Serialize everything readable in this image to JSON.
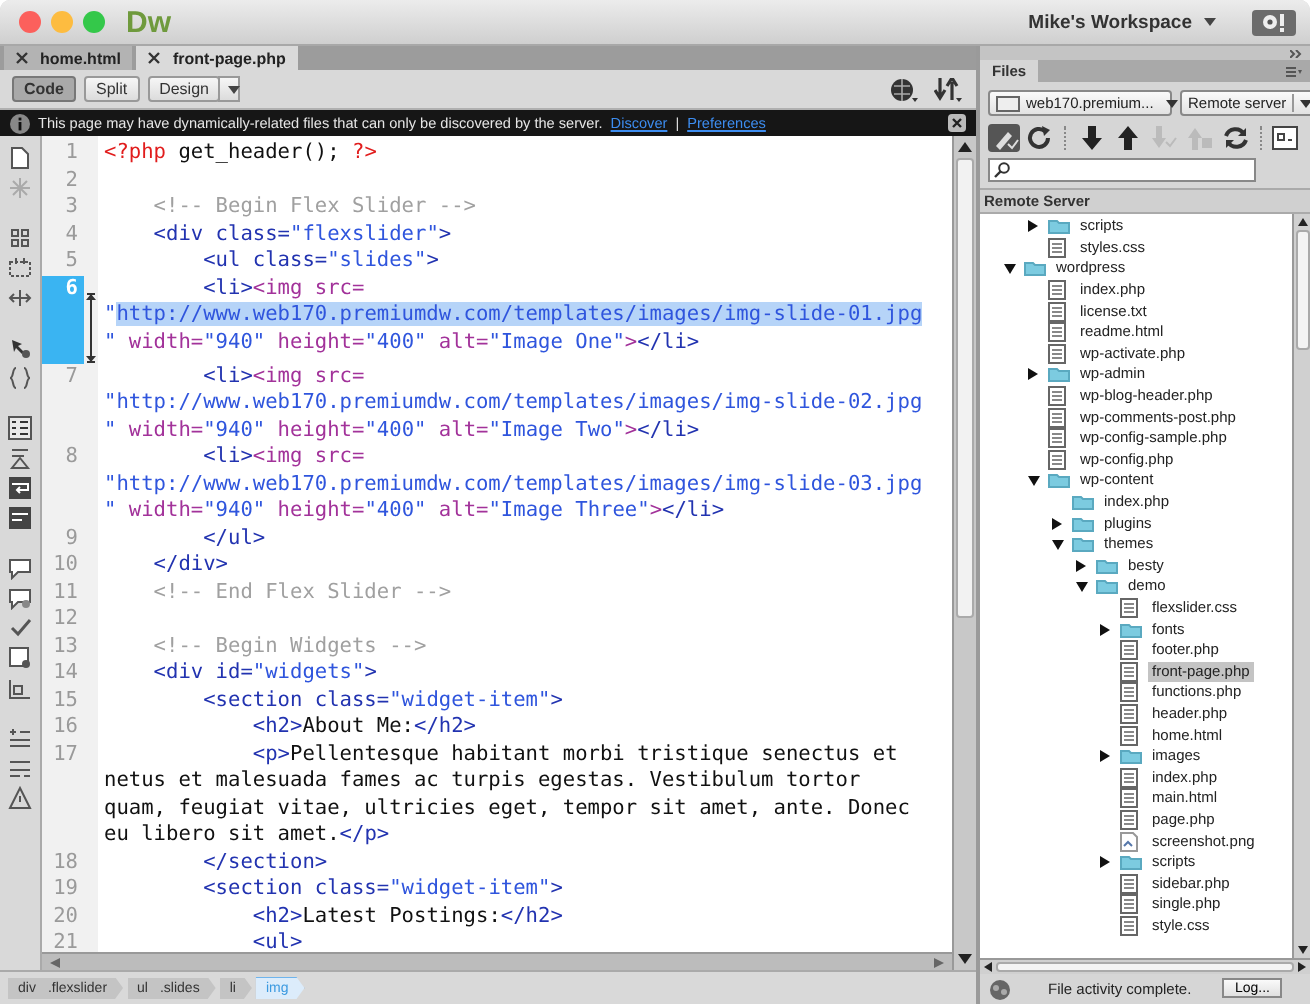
{
  "window": {
    "app_logo": "Dw",
    "workspace": "Mike's Workspace"
  },
  "document_tabs": [
    {
      "label": "home.html",
      "selected": false
    },
    {
      "label": "front-page.php",
      "selected": true
    }
  ],
  "view_buttons": [
    {
      "label": "Code",
      "selected": true
    },
    {
      "label": "Split",
      "selected": false
    },
    {
      "label": "Design",
      "selected": false
    }
  ],
  "info_bar": {
    "message": "This page may have dynamically-related files that can only be discovered by the server.",
    "links": [
      "Discover",
      "Preferences"
    ],
    "separator": "|"
  },
  "code_lines": [
    {
      "number": "1",
      "selected": false,
      "wraps": [
        {
          "spans": [
            {
              "kind": "php",
              "text": "<?php"
            },
            {
              "kind": "text",
              "text": " get_header(); "
            },
            {
              "kind": "php",
              "text": "?>"
            }
          ]
        }
      ]
    },
    {
      "number": "2",
      "selected": false
    },
    {
      "number": "3",
      "selected": false,
      "wraps": [
        {
          "spans": [
            {
              "kind": "comment",
              "text": "    <!-- Begin Flex Slider -->"
            }
          ]
        }
      ]
    },
    {
      "number": "4",
      "selected": false,
      "wraps": [
        {
          "spans": [
            {
              "kind": "tag",
              "text": "    <div class="
            },
            {
              "kind": "value",
              "text": "\"flexslider\""
            },
            {
              "kind": "tag",
              "text": ">"
            }
          ]
        }
      ]
    },
    {
      "number": "5",
      "selected": false,
      "wraps": [
        {
          "spans": [
            {
              "kind": "tag",
              "text": "        <ul class="
            },
            {
              "kind": "value",
              "text": "\"slides\""
            },
            {
              "kind": "tag",
              "text": ">"
            }
          ]
        }
      ]
    },
    {
      "number": "6",
      "selected": true,
      "wraps": [
        {
          "spans": [
            {
              "kind": "tag",
              "text": "        <li>"
            },
            {
              "kind": "img",
              "text": "<img src="
            }
          ]
        },
        {
          "spans": [
            {
              "kind": "value",
              "text": "\""
            },
            {
              "kind": "selected-text",
              "text": "http://www.web170.premiumdw.com/templates/images/img-slide-01.jpg"
            }
          ]
        },
        {
          "spans": [
            {
              "kind": "value",
              "text": "\""
            },
            {
              "kind": "img",
              "text": " width="
            },
            {
              "kind": "value",
              "text": "\"940\""
            },
            {
              "kind": "img",
              "text": " height="
            },
            {
              "kind": "value",
              "text": "\"400\""
            },
            {
              "kind": "img",
              "text": " alt="
            },
            {
              "kind": "value",
              "text": "\"Image One\""
            },
            {
              "kind": "img",
              "text": ">"
            },
            {
              "kind": "tag",
              "text": "</li>"
            }
          ]
        }
      ]
    },
    {
      "number": "7",
      "selected": false,
      "wraps": [
        {
          "spans": [
            {
              "kind": "tag",
              "text": "        <li>"
            },
            {
              "kind": "img",
              "text": "<img src="
            }
          ]
        },
        {
          "spans": [
            {
              "kind": "value",
              "text": "\"http://www.web170.premiumdw.com/templates/images/img-slide-02.jpg"
            }
          ]
        },
        {
          "spans": [
            {
              "kind": "value",
              "text": "\""
            },
            {
              "kind": "img",
              "text": " width="
            },
            {
              "kind": "value",
              "text": "\"940\""
            },
            {
              "kind": "img",
              "text": " height="
            },
            {
              "kind": "value",
              "text": "\"400\""
            },
            {
              "kind": "img",
              "text": " alt="
            },
            {
              "kind": "value",
              "text": "\"Image Two\""
            },
            {
              "kind": "img",
              "text": ">"
            },
            {
              "kind": "tag",
              "text": "</li>"
            }
          ]
        }
      ]
    },
    {
      "number": "8",
      "selected": false,
      "wraps": [
        {
          "spans": [
            {
              "kind": "tag",
              "text": "        <li>"
            },
            {
              "kind": "img",
              "text": "<img src="
            }
          ]
        },
        {
          "spans": [
            {
              "kind": "value",
              "text": "\"http://www.web170.premiumdw.com/templates/images/img-slide-03.jpg"
            }
          ]
        },
        {
          "spans": [
            {
              "kind": "value",
              "text": "\""
            },
            {
              "kind": "img",
              "text": " width="
            },
            {
              "kind": "value",
              "text": "\"940\""
            },
            {
              "kind": "img",
              "text": " height="
            },
            {
              "kind": "value",
              "text": "\"400\""
            },
            {
              "kind": "img",
              "text": " alt="
            },
            {
              "kind": "value",
              "text": "\"Image Three\""
            },
            {
              "kind": "img",
              "text": ">"
            },
            {
              "kind": "tag",
              "text": "</li>"
            }
          ]
        }
      ]
    },
    {
      "number": "9",
      "selected": false,
      "wraps": [
        {
          "spans": [
            {
              "kind": "tag",
              "text": "        </ul>"
            }
          ]
        }
      ]
    },
    {
      "number": "10",
      "selected": false,
      "wraps": [
        {
          "spans": [
            {
              "kind": "tag",
              "text": "    </div>"
            }
          ]
        }
      ]
    },
    {
      "number": "11",
      "selected": false,
      "wraps": [
        {
          "spans": [
            {
              "kind": "comment",
              "text": "    <!-- End Flex Slider -->"
            }
          ]
        }
      ]
    },
    {
      "number": "12",
      "selected": false
    },
    {
      "number": "13",
      "selected": false,
      "wraps": [
        {
          "spans": [
            {
              "kind": "comment",
              "text": "    <!-- Begin Widgets -->"
            }
          ]
        }
      ]
    },
    {
      "number": "14",
      "selected": false,
      "wraps": [
        {
          "spans": [
            {
              "kind": "tag",
              "text": "    <div id="
            },
            {
              "kind": "value",
              "text": "\"widgets\""
            },
            {
              "kind": "tag",
              "text": ">"
            }
          ]
        }
      ]
    },
    {
      "number": "15",
      "selected": false,
      "wraps": [
        {
          "spans": [
            {
              "kind": "tag",
              "text": "        <section class="
            },
            {
              "kind": "value",
              "text": "\"widget-item\""
            },
            {
              "kind": "tag",
              "text": ">"
            }
          ]
        }
      ]
    },
    {
      "number": "16",
      "selected": false,
      "wraps": [
        {
          "spans": [
            {
              "kind": "tag",
              "text": "            <h2>"
            },
            {
              "kind": "text",
              "text": "About Me:"
            },
            {
              "kind": "tag",
              "text": "</h2>"
            }
          ]
        }
      ]
    },
    {
      "number": "17",
      "selected": false,
      "wraps": [
        {
          "spans": [
            {
              "kind": "tag",
              "text": "            <p>"
            },
            {
              "kind": "text",
              "text": "Pellentesque habitant morbi tristique senectus et"
            }
          ]
        },
        {
          "spans": [
            {
              "kind": "text",
              "text": "netus et malesuada fames ac turpis egestas. Vestibulum tortor"
            }
          ]
        },
        {
          "spans": [
            {
              "kind": "text",
              "text": "quam, feugiat vitae, ultricies eget, tempor sit amet, ante. Donec"
            }
          ]
        },
        {
          "spans": [
            {
              "kind": "text",
              "text": "eu libero sit amet."
            },
            {
              "kind": "tag",
              "text": "</p>"
            }
          ]
        }
      ]
    },
    {
      "number": "18",
      "selected": false,
      "wraps": [
        {
          "spans": [
            {
              "kind": "tag",
              "text": "        </section>"
            }
          ]
        }
      ]
    },
    {
      "number": "19",
      "selected": false,
      "wraps": [
        {
          "spans": [
            {
              "kind": "tag",
              "text": "        <section class="
            },
            {
              "kind": "value",
              "text": "\"widget-item\""
            },
            {
              "kind": "tag",
              "text": ">"
            }
          ]
        }
      ]
    },
    {
      "number": "20",
      "selected": false,
      "wraps": [
        {
          "spans": [
            {
              "kind": "tag",
              "text": "            <h2>"
            },
            {
              "kind": "text",
              "text": "Latest Postings:"
            },
            {
              "kind": "tag",
              "text": "</h2>"
            }
          ]
        }
      ]
    },
    {
      "number": "21",
      "selected": false,
      "wraps": [
        {
          "spans": [
            {
              "kind": "tag",
              "text": "            <ul>"
            }
          ]
        }
      ]
    }
  ],
  "tag_selector": [
    {
      "tag": "div",
      "class": ".flexslider",
      "selected": false
    },
    {
      "tag": "ul",
      "class": ".slides",
      "selected": false
    },
    {
      "tag": "li",
      "selected": false
    },
    {
      "tag": "img",
      "selected": true
    }
  ],
  "files_panel": {
    "tab": "Files",
    "site": "web170.premium...",
    "server": "Remote server",
    "header": "Remote Server",
    "tree": {
      "scrolled_children": [
        {
          "name": "scripts",
          "kind": "folder",
          "expanded": false,
          "selected": false
        },
        {
          "name": "styles.css",
          "kind": "file",
          "selected": false
        }
      ],
      "items": [
        {
          "name": "wordpress",
          "kind": "folder",
          "expanded": true,
          "selected": false,
          "children": [
            {
              "name": "index.php",
              "kind": "file",
              "selected": false
            },
            {
              "name": "license.txt",
              "kind": "file",
              "selected": false
            },
            {
              "name": "readme.html",
              "kind": "file",
              "selected": false
            },
            {
              "name": "wp-activate.php",
              "kind": "file",
              "selected": false
            },
            {
              "name": "wp-admin",
              "kind": "folder",
              "expanded": false,
              "selected": false
            },
            {
              "name": "wp-blog-header.php",
              "kind": "file",
              "selected": false
            },
            {
              "name": "wp-comments-post.php",
              "kind": "file",
              "selected": false
            },
            {
              "name": "wp-config-sample.php",
              "kind": "file",
              "selected": false
            },
            {
              "name": "wp-config.php",
              "kind": "file",
              "selected": false
            },
            {
              "name": "wp-content",
              "kind": "folder",
              "expanded": true,
              "selected": false,
              "children": [
                {
                  "name": "index.php",
                  "kind": "folder",
                  "selected": false
                },
                {
                  "name": "plugins",
                  "kind": "folder",
                  "expanded": false,
                  "selected": false
                },
                {
                  "name": "themes",
                  "kind": "folder",
                  "expanded": true,
                  "selected": false,
                  "children": [
                    {
                      "name": "besty",
                      "kind": "folder",
                      "expanded": false,
                      "selected": false
                    },
                    {
                      "name": "demo",
                      "kind": "folder",
                      "expanded": true,
                      "selected": false,
                      "children": [
                        {
                          "name": "flexslider.css",
                          "kind": "file",
                          "selected": false
                        },
                        {
                          "name": "fonts",
                          "kind": "folder",
                          "expanded": false,
                          "selected": false
                        },
                        {
                          "name": "footer.php",
                          "kind": "file",
                          "selected": false
                        },
                        {
                          "name": "front-page.php",
                          "kind": "file",
                          "selected": true
                        },
                        {
                          "name": "functions.php",
                          "kind": "file",
                          "selected": false
                        },
                        {
                          "name": "header.php",
                          "kind": "file",
                          "selected": false
                        },
                        {
                          "name": "home.html",
                          "kind": "file",
                          "selected": false
                        },
                        {
                          "name": "images",
                          "kind": "folder",
                          "expanded": false,
                          "selected": false
                        },
                        {
                          "name": "index.php",
                          "kind": "file",
                          "selected": false
                        },
                        {
                          "name": "main.html",
                          "kind": "file",
                          "selected": false
                        },
                        {
                          "name": "page.php",
                          "kind": "file",
                          "selected": false
                        },
                        {
                          "name": "screenshot.png",
                          "kind": "image",
                          "selected": false
                        },
                        {
                          "name": "scripts",
                          "kind": "folder",
                          "expanded": false,
                          "selected": false
                        },
                        {
                          "name": "sidebar.php",
                          "kind": "file",
                          "selected": false
                        },
                        {
                          "name": "single.php",
                          "kind": "file",
                          "selected": false
                        },
                        {
                          "name": "style.css",
                          "kind": "file",
                          "selected": false
                        }
                      ]
                    }
                  ]
                }
              ]
            }
          ]
        }
      ]
    },
    "status": "File activity complete.",
    "log_button": "Log..."
  }
}
